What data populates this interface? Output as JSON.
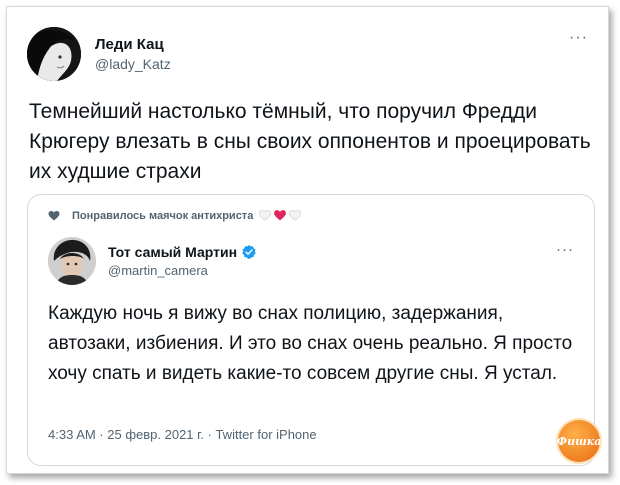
{
  "tweet": {
    "author_name": "Леди Кац",
    "author_handle": "@lady_Katz",
    "more": "···",
    "text": "Темнейший настолько тёмный, что поручил Фредди Крюгеру влезать в сны своих оппонентов и проецировать их худшие страхи"
  },
  "quoted": {
    "liked_text": "Понравилось маячок антихриста",
    "author_name": "Тот самый Мартин",
    "author_handle": "@martin_camera",
    "more": "···",
    "text": "Каждую ночь я вижу во снах полицию, задержания, автозаки, избиения. И это во снах очень реально. Я просто хочу спать и видеть какие-то совсем другие сны. Я устал.",
    "meta": "4:33 AM · 25 февр. 2021 г. · Twitter for iPhone"
  },
  "colors": {
    "text": "#0f1419",
    "secondary": "#536471",
    "border": "#cfd9de",
    "verified": "#1d9bf0",
    "heart_red": "#e0245e"
  },
  "icons": {
    "liked": "heart-icon",
    "verified": "verified-badge-icon",
    "more": "more-icon"
  },
  "watermark": {
    "label": "Фишка"
  }
}
